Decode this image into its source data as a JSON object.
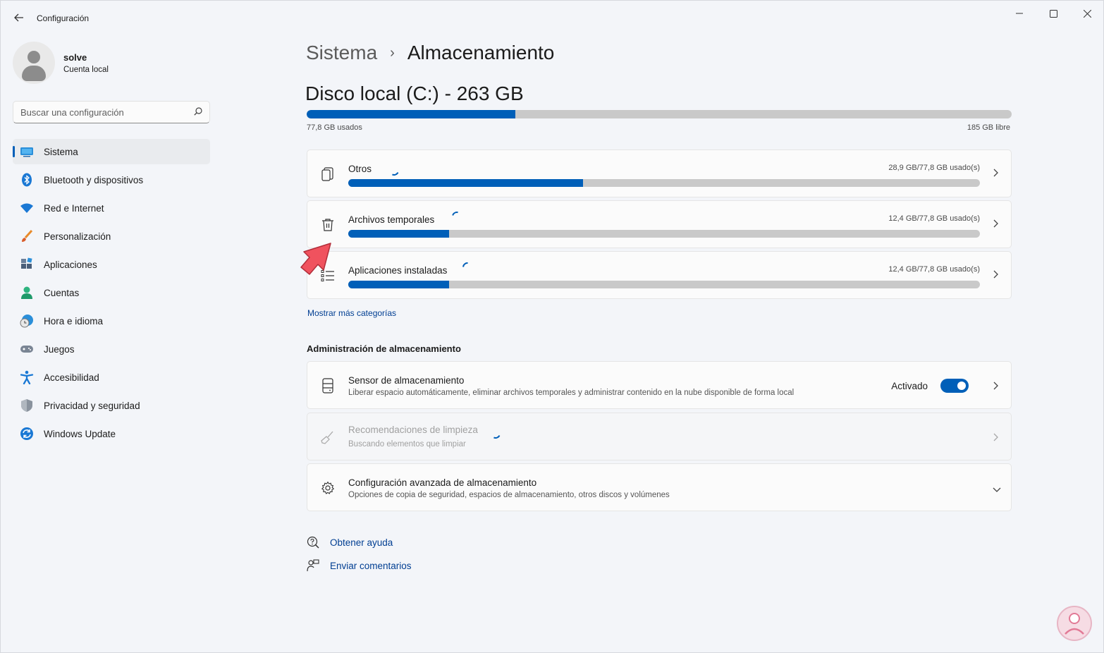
{
  "app": {
    "title": "Configuración"
  },
  "profile": {
    "name": "solve",
    "account_type": "Cuenta local"
  },
  "search": {
    "placeholder": "Buscar una configuración"
  },
  "sidebar": {
    "items": [
      {
        "label": "Sistema",
        "icon": "system-icon",
        "active": true
      },
      {
        "label": "Bluetooth y dispositivos",
        "icon": "bluetooth-icon"
      },
      {
        "label": "Red e Internet",
        "icon": "wifi-icon"
      },
      {
        "label": "Personalización",
        "icon": "brush-icon"
      },
      {
        "label": "Aplicaciones",
        "icon": "apps-icon"
      },
      {
        "label": "Cuentas",
        "icon": "account-icon"
      },
      {
        "label": "Hora e idioma",
        "icon": "clock-globe-icon"
      },
      {
        "label": "Juegos",
        "icon": "gamepad-icon"
      },
      {
        "label": "Accesibilidad",
        "icon": "accessibility-icon"
      },
      {
        "label": "Privacidad y seguridad",
        "icon": "shield-icon"
      },
      {
        "label": "Windows Update",
        "icon": "update-icon"
      }
    ]
  },
  "breadcrumb": {
    "parent": "Sistema",
    "separator": "›",
    "current": "Almacenamiento"
  },
  "disk": {
    "title": "Disco local (C:) - 263 GB",
    "used_label": "77,8 GB usados",
    "free_label": "185 GB libre",
    "used_fraction": 0.296
  },
  "categories": [
    {
      "label": "Otros",
      "size": "28,9 GB/77,8 GB usado(s)",
      "fraction": 0.372,
      "icon": "files-icon"
    },
    {
      "label": "Archivos temporales",
      "size": "12,4 GB/77,8 GB usado(s)",
      "fraction": 0.16,
      "icon": "trash-icon"
    },
    {
      "label": "Aplicaciones instaladas",
      "size": "12,4 GB/77,8 GB usado(s)",
      "fraction": 0.16,
      "icon": "list-icon"
    }
  ],
  "more_categories": "Mostrar más categorías",
  "management": {
    "title": "Administración de almacenamiento",
    "sensor": {
      "title": "Sensor de almacenamiento",
      "desc": "Liberar espacio automáticamente, eliminar archivos temporales y administrar contenido en la nube disponible de forma local",
      "state_label": "Activado",
      "enabled": true
    },
    "cleanup": {
      "title": "Recomendaciones de limpieza",
      "desc": "Buscando elementos que limpiar"
    },
    "advanced": {
      "title": "Configuración avanzada de almacenamiento",
      "desc": "Opciones de copia de seguridad, espacios de almacenamiento, otros discos y volúmenes"
    }
  },
  "help": {
    "get_help": "Obtener ayuda",
    "feedback": "Enviar comentarios"
  },
  "colors": {
    "accent": "#005fb8",
    "bar_bg": "#c9c9c9",
    "annotation": "#f0525e"
  }
}
